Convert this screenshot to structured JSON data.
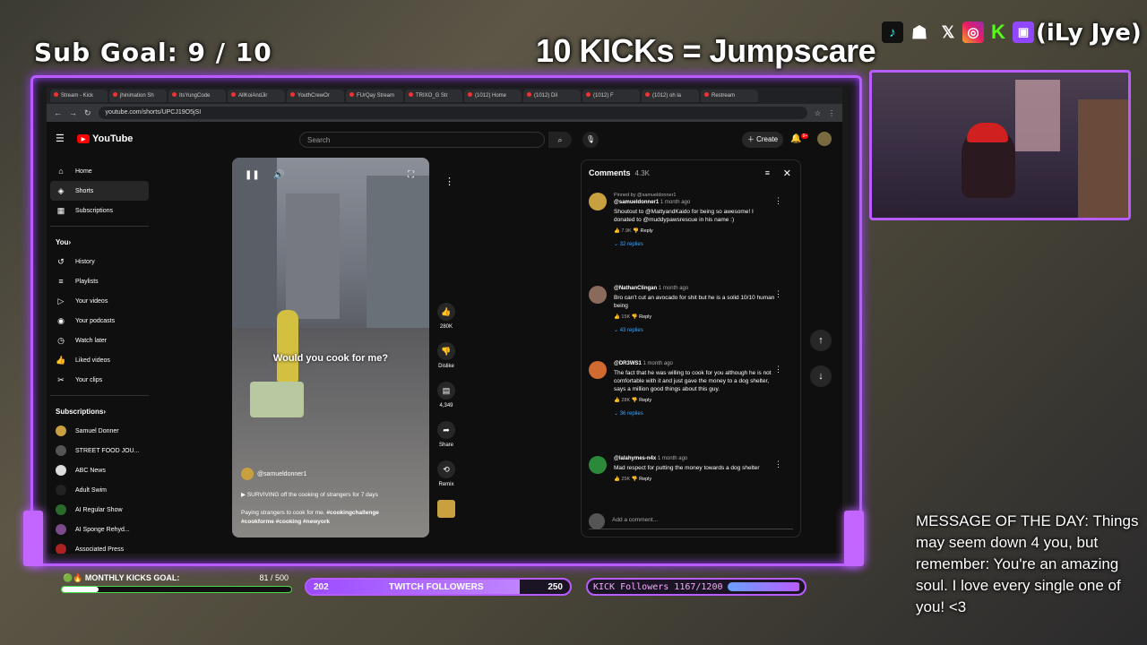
{
  "overlay": {
    "sub_goal": "Sub Goal:  9 / 10",
    "kicks_title": "10 KICKs = Jumpscare",
    "handle": "(iLy Jye)",
    "socials": [
      "tiktok-icon",
      "snapchat-icon",
      "x-icon",
      "instagram-icon",
      "kick-icon",
      "twitch-icon"
    ],
    "motd": "MESSAGE OF THE DAY: Things may seem down 4 you, but remember: You're an amazing soul. I love every single one of you! <3",
    "monthly_kicks_label": "MONTHLY KICKS GOAL:",
    "monthly_kicks_value": "81 / 500",
    "monthly_kicks_progress": 0.162,
    "twitch_current": "202",
    "twitch_label": "TWITCH FOLLOWERS",
    "twitch_goal": "250",
    "twitch_progress": 0.81,
    "kick_followers_label": "KICK Followers 1167/1200",
    "kick_followers_progress": 0.97,
    "colors": {
      "neon": "#b85cff",
      "kick_green": "#4ade4a"
    }
  },
  "browser": {
    "tabs": [
      "Stream - Kick",
      "jhinimation Sh",
      "ItsYungCode",
      "AllKoiAndJir",
      "YouthCrewOr",
      "FUrQay Stream",
      "TRIXO_G Str",
      "(1012) Home",
      "(1012) Dil",
      "(1012) F",
      "(1012) oh la",
      "Restream"
    ],
    "url": "youtube.com/shorts/UPCJ19O5jSI"
  },
  "youtube": {
    "logo": "YouTube",
    "search_placeholder": "Search",
    "create_label": "Create",
    "notif_count": "9+",
    "sidebar": {
      "main": [
        {
          "label": "Home",
          "icon": "home-icon"
        },
        {
          "label": "Shorts",
          "icon": "shorts-icon"
        },
        {
          "label": "Subscriptions",
          "icon": "subscriptions-icon"
        }
      ],
      "you_label": "You",
      "you_items": [
        {
          "label": "History",
          "icon": "history-icon"
        },
        {
          "label": "Playlists",
          "icon": "playlist-icon"
        },
        {
          "label": "Your videos",
          "icon": "video-icon"
        },
        {
          "label": "Your podcasts",
          "icon": "podcast-icon"
        },
        {
          "label": "Watch later",
          "icon": "clock-icon"
        },
        {
          "label": "Liked videos",
          "icon": "like-icon"
        },
        {
          "label": "Your clips",
          "icon": "scissors-icon"
        }
      ],
      "subs_label": "Subscriptions",
      "subs": [
        "Samuel Donner",
        "STREET FOOD JOU...",
        "ABC News",
        "Adult Swim",
        "AI Regular Show",
        "AI Sponge Rehyd...",
        "Associated Press"
      ]
    },
    "short": {
      "caption": "Would you cook for me?",
      "channel": "@samueldonner1",
      "title": "SURVIVING off the cooking of strangers for 7 days",
      "desc_prefix": "Paying strangers to cook for me.",
      "desc_tags": "#cookingchallenge #cookforme #cooking #newyork",
      "likes": "280K",
      "dislike": "Dislike",
      "comments": "4,349",
      "share": "Share",
      "remix": "Remix"
    },
    "comments": {
      "title": "Comments",
      "count": "4.3K",
      "items": [
        {
          "pinned": "Pinned by @samueldonner1",
          "author": "@samueldonner1",
          "time": "1 month ago",
          "text": "Shoutout to @MattyandKaido for being so awesome! I donated to @muddypawsrescue in his name :)",
          "likes": "7.9K",
          "reply": "Reply",
          "replies": "32 replies",
          "color": "#c8a040"
        },
        {
          "pinned": "",
          "author": "@NathanClingan",
          "time": "1 month ago",
          "text": "Bro can't cut an avocado for shit but he is a solid 10/10 human being",
          "likes": "15K",
          "reply": "Reply",
          "replies": "43 replies",
          "color": "#8a6a5a"
        },
        {
          "pinned": "",
          "author": "@DR3WS1",
          "time": "1 month ago",
          "text": "The fact that he was willing to cook for you although he is not comfortable with it and just gave the money to a dog shelter, says a million good things about this guy.",
          "likes": "28K",
          "reply": "Reply",
          "replies": "36 replies",
          "color": "#d06a30"
        },
        {
          "pinned": "",
          "author": "@lalahymes-n4x",
          "time": "1 month ago",
          "text": "Mad respect for putting the money towards a dog shelter",
          "likes": "25K",
          "reply": "Reply",
          "replies": "",
          "color": "#2a8a3a"
        }
      ],
      "add_placeholder": "Add a comment..."
    }
  }
}
